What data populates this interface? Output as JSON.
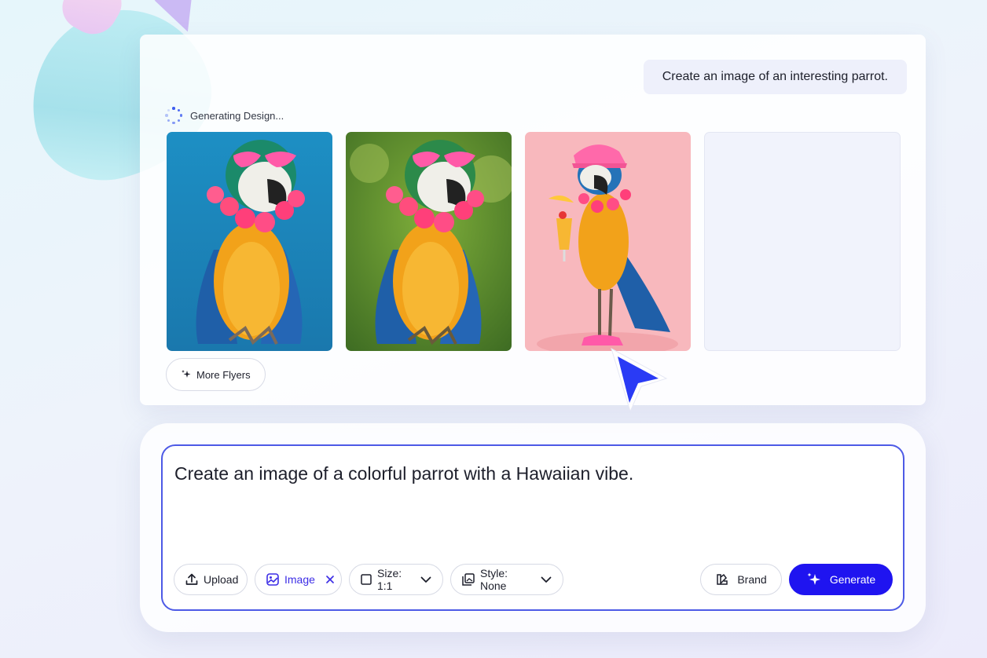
{
  "conversation": {
    "user_prompt": "Create an image of an interesting parrot.",
    "status_text": "Generating Design...",
    "more_button_label": "More Flyers",
    "images": [
      {
        "icon": "parrot-heart-sunglasses-blue-bg"
      },
      {
        "icon": "parrot-heart-sunglasses-green-bg"
      },
      {
        "icon": "parrot-cap-cocktail-pink-bg"
      }
    ]
  },
  "composer": {
    "input_text": "Create an image of a colorful parrot with a Hawaiian vibe.",
    "upload_label": "Upload",
    "image_label": "Image",
    "size_label": "Size: 1:1",
    "style_label": "Style: None",
    "brand_label": "Brand",
    "generate_label": "Generate"
  },
  "colors": {
    "accent": "#1f14f0",
    "composer_border": "#4d5ae6",
    "image_chip_text": "#3d2ee6"
  }
}
